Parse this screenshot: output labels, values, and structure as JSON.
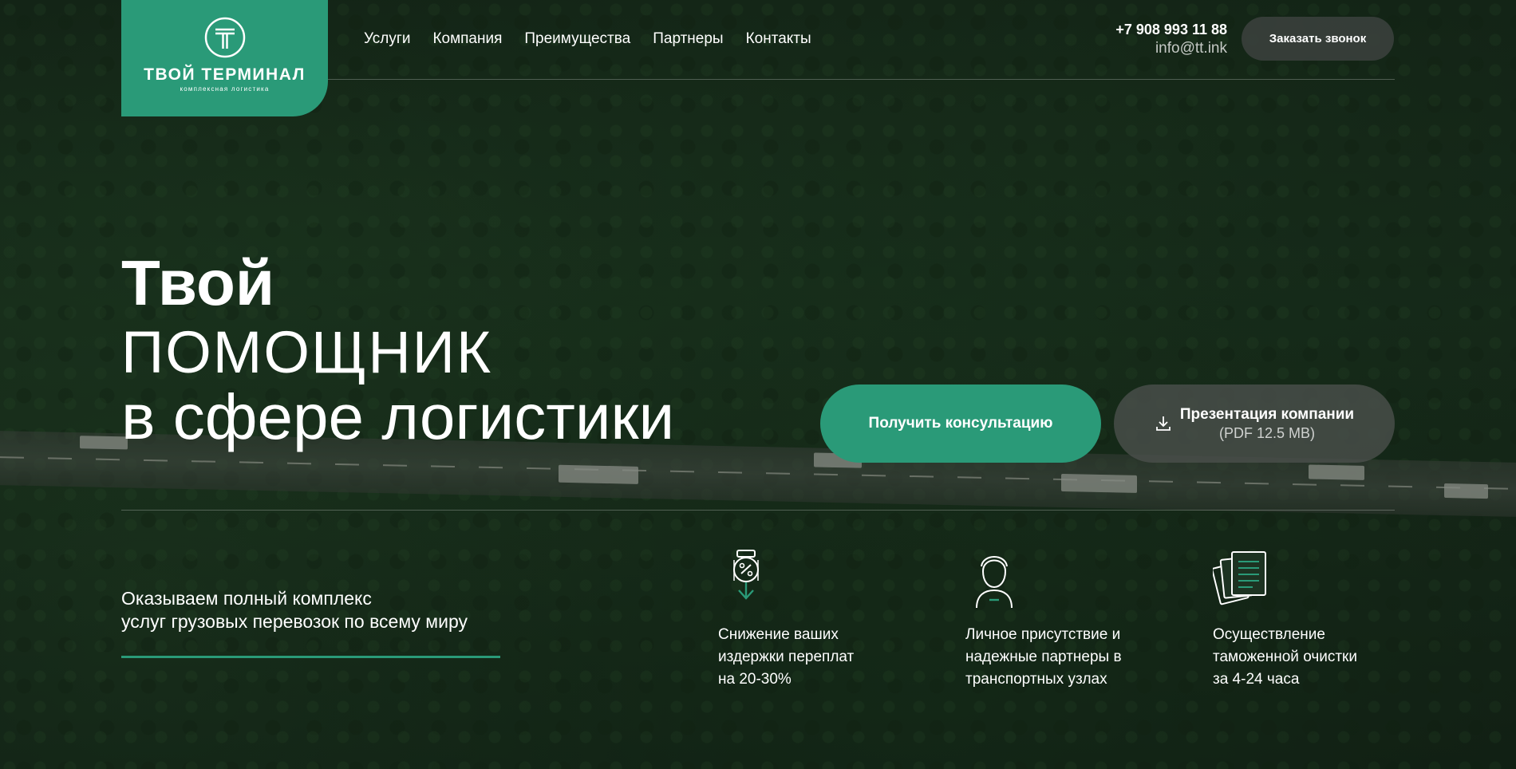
{
  "logo": {
    "title": "ТВОЙ ТЕРМИНАЛ",
    "subtitle": "комплексная логистика"
  },
  "nav": {
    "items": [
      "Услуги",
      "Компания",
      "Преимущества",
      "Партнеры",
      "Контакты"
    ]
  },
  "contacts": {
    "phone": "+7 908 993 11 88",
    "email": "info@tt.ink"
  },
  "header": {
    "call_button": "Заказать звонок"
  },
  "hero": {
    "line1": "Твой",
    "line2": "ПОМОЩНИК",
    "line3": "в сфере логистики"
  },
  "buttons": {
    "consult": "Получить консультацию",
    "presentation_title": "Презентация компании",
    "presentation_size": "(PDF 12.5 MB)"
  },
  "tagline": {
    "line1": "Оказываем полный комплекс",
    "line2": "услуг грузовых перевозок по всему миру"
  },
  "features": [
    {
      "icon": "savings-icon",
      "line1": "Снижение ваших",
      "line2": "издержки переплат",
      "line3": "на 20-30%"
    },
    {
      "icon": "person-icon",
      "line1": "Личное присутствие и",
      "line2": "надежные партнеры в",
      "line3": "транспортных узлах"
    },
    {
      "icon": "documents-icon",
      "line1": "Осуществление",
      "line2": "таможенной очистки",
      "line3": "за 4-24 часа"
    }
  ],
  "colors": {
    "accent": "#2a9a78",
    "background": "#1b3220"
  }
}
